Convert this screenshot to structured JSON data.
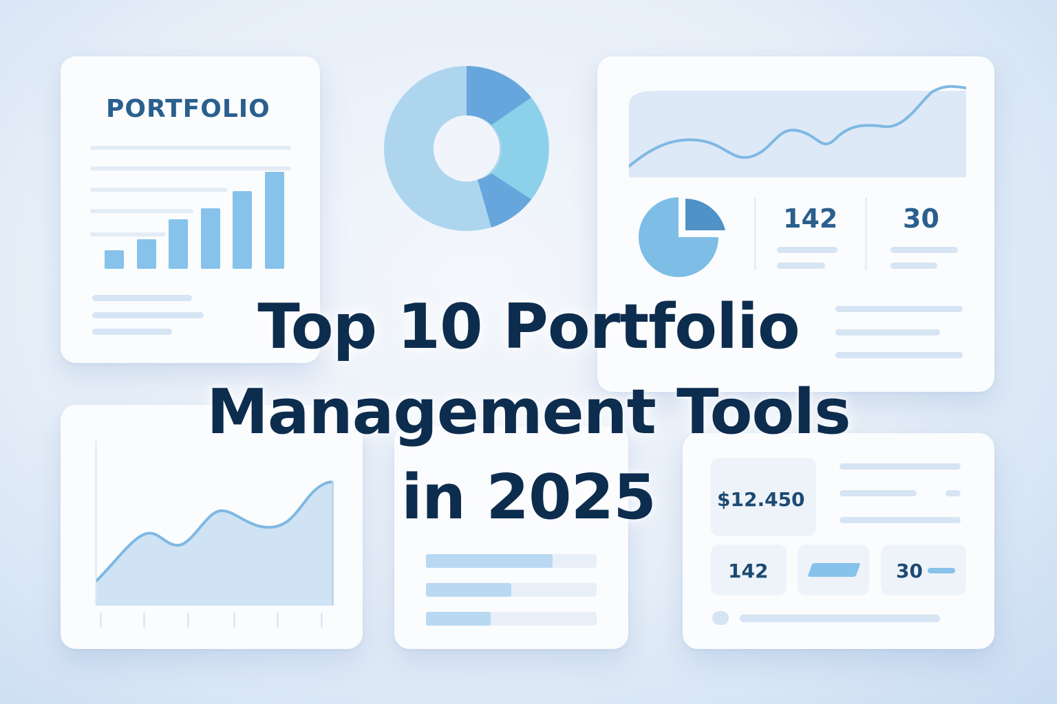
{
  "headline": {
    "line1": "Top 10 Portfolio",
    "line2": "Management Tools",
    "line3": "in 2025"
  },
  "portfolio_card": {
    "title": "PORTFOLIO",
    "bar_values": [
      27,
      43,
      72,
      88,
      113,
      141
    ]
  },
  "dashboard_card": {
    "stat_a": "142",
    "stat_b": "30"
  },
  "summary_card": {
    "balance": "$12.450",
    "stat_a": "142",
    "stat_b": "30"
  },
  "progress_card": {
    "progress": [
      0.74,
      0.5,
      0.38
    ]
  },
  "colors": {
    "headline": "#0d2d4f",
    "accent": "#86c2ea",
    "accent_dark": "#5a9fd6",
    "label": "#2a5f8e"
  }
}
